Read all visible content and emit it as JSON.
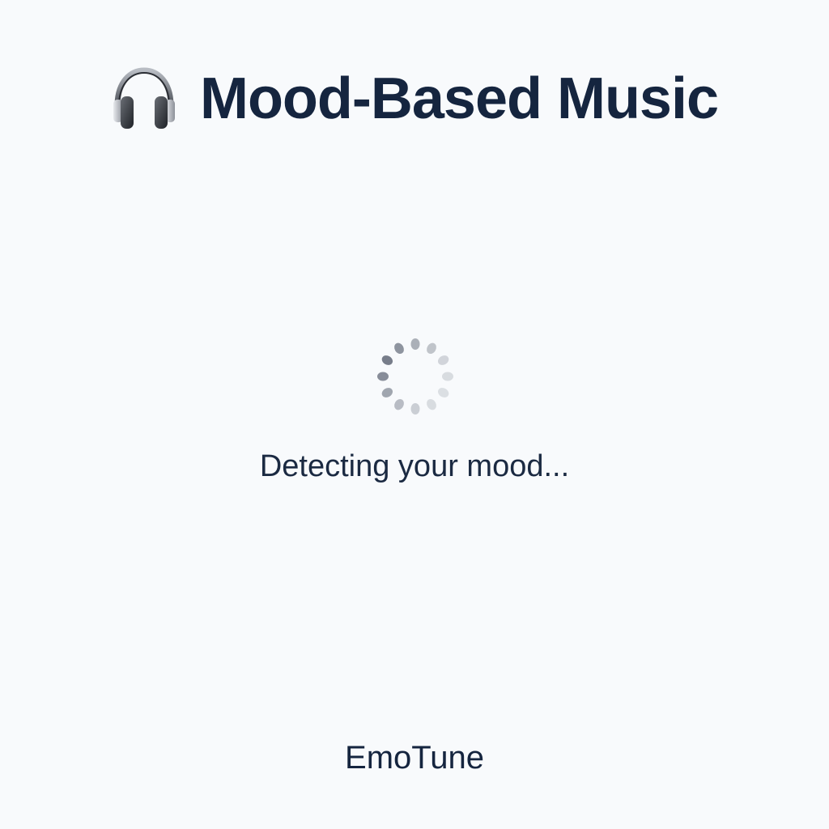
{
  "header": {
    "icon": "headphones-icon",
    "title": "Mood-Based Music"
  },
  "loader": {
    "icon": "spinner-icon",
    "status_text": "Detecting your mood..."
  },
  "footer": {
    "brand": "EmoTune"
  },
  "colors": {
    "background": "#f8fafc",
    "text": "#15253f",
    "spinner": "#6b7280"
  }
}
